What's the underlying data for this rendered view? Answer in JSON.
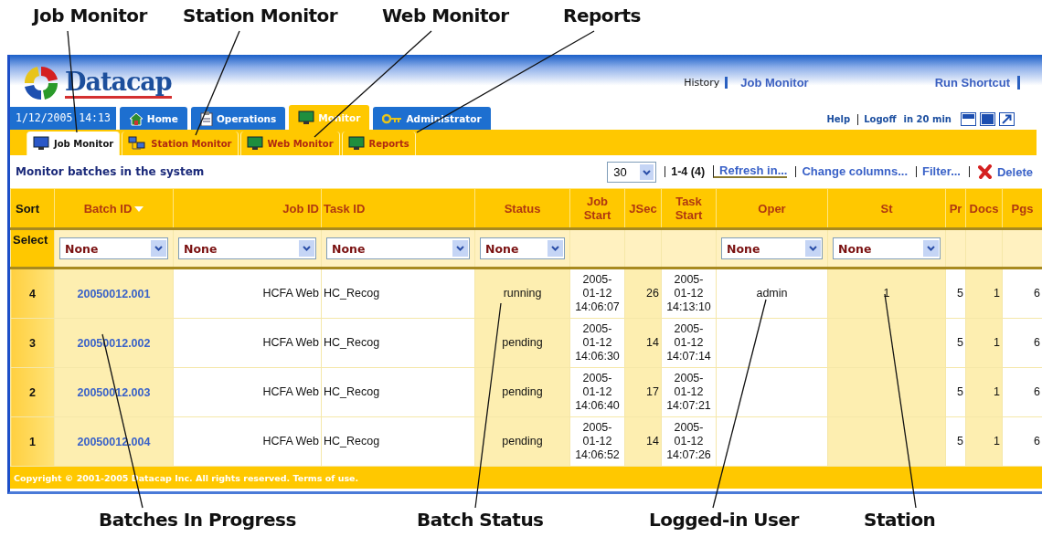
{
  "callouts_top": [
    {
      "label": "Job Monitor"
    },
    {
      "label": "Station Monitor"
    },
    {
      "label": "Web Monitor"
    },
    {
      "label": "Reports"
    }
  ],
  "callouts_bottom": [
    {
      "label": "Batches In Progress"
    },
    {
      "label": "Batch Status"
    },
    {
      "label": "Logged-in User"
    },
    {
      "label": "Station"
    }
  ],
  "header": {
    "logo": "Datacap",
    "history": "History",
    "job_monitor": "Job Monitor",
    "run_shortcut": "Run Shortcut",
    "date": "1/12/2005 14:13",
    "help": "Help",
    "logoff": "Logoff",
    "logoff_note": "in 20 min"
  },
  "tabs": [
    {
      "label": "Home",
      "selected": false
    },
    {
      "label": "Operations",
      "selected": false
    },
    {
      "label": "Monitor",
      "selected": true
    },
    {
      "label": "Administrator",
      "selected": false
    }
  ],
  "subtabs": [
    {
      "label": "Job Monitor",
      "selected": true
    },
    {
      "label": "Station Monitor",
      "selected": false
    },
    {
      "label": "Web Monitor",
      "selected": false
    },
    {
      "label": "Reports",
      "selected": false
    }
  ],
  "toolbar": {
    "title": "Monitor batches in the system",
    "page_size": "30",
    "range": "1-4 (4)",
    "links": [
      "Refresh in...",
      "Change columns...",
      "Filter..."
    ],
    "delete": "Delete"
  },
  "table": {
    "sort_label": "Sort",
    "select_label": "Select",
    "columns": [
      {
        "label": "Batch ID",
        "sort_descending": true,
        "filter": "None"
      },
      {
        "label": "Job ID",
        "sort_descending": false,
        "filter": "None"
      },
      {
        "label": "Task ID",
        "sort_descending": false,
        "filter": "None"
      },
      {
        "label": "Status",
        "sort_descending": false,
        "filter": "None"
      },
      {
        "label": "Job Start",
        "sort_descending": false
      },
      {
        "label": "JSec",
        "sort_descending": false
      },
      {
        "label": "Task Start",
        "sort_descending": false
      },
      {
        "label": "Oper",
        "sort_descending": false,
        "filter": "None"
      },
      {
        "label": "St",
        "sort_descending": false,
        "filter": "None"
      },
      {
        "label": "Pr",
        "sort_descending": false
      },
      {
        "label": "Docs",
        "sort_descending": false
      },
      {
        "label": "Pgs",
        "sort_descending": false
      }
    ],
    "rows": [
      {
        "sort": "4",
        "cells": [
          "20050012.001",
          "HCFA Web",
          "HC_Recog",
          "running",
          "2005-\n01-12\n14:06:07",
          "26",
          "2005-\n01-12\n14:13:10",
          "admin",
          "1",
          "5",
          "1",
          "6"
        ]
      },
      {
        "sort": "3",
        "cells": [
          "20050012.002",
          "HCFA Web",
          "HC_Recog",
          "pending",
          "2005-\n01-12\n14:06:30",
          "14",
          "2005-\n01-12\n14:07:14",
          null,
          null,
          "5",
          "1",
          "6"
        ]
      },
      {
        "sort": "2",
        "cells": [
          "20050012.003",
          "HCFA Web",
          "HC_Recog",
          "pending",
          "2005-\n01-12\n14:06:40",
          "17",
          "2005-\n01-12\n14:07:21",
          null,
          null,
          "5",
          "1",
          "6"
        ]
      },
      {
        "sort": "1",
        "cells": [
          "20050012.004",
          "HCFA Web",
          "HC_Recog",
          "pending",
          "2005-\n01-12\n14:06:52",
          "14",
          "2005-\n01-12\n14:07:26",
          null,
          null,
          "5",
          "1",
          "6"
        ]
      }
    ]
  },
  "footer": {
    "text": "Copyright © 2001-2005 Datacap Inc. All rights reserved.",
    "link": "Terms of use."
  }
}
